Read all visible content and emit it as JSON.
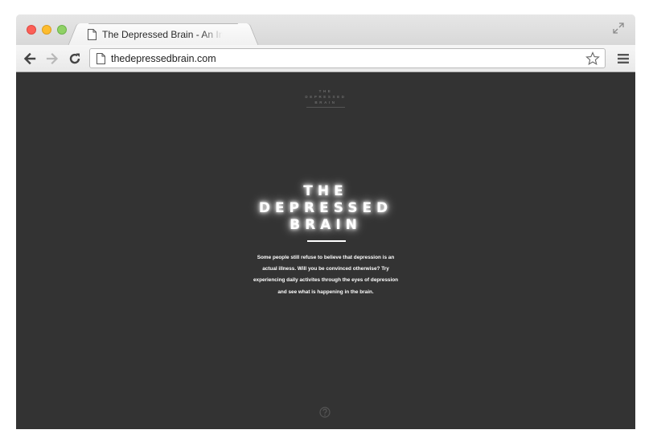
{
  "browser": {
    "tab_title": "The Depressed Brain - An Interactive Experience",
    "url": "thedepressedbrain.com"
  },
  "page": {
    "small_logo": [
      "THE",
      "DEPRESSED",
      "BRAIN"
    ],
    "hero_title": [
      "THE",
      "DEPRESSED",
      "BRAIN"
    ],
    "description": "Some people still refuse to believe that depression is an actual illness. Will you be convinced otherwise? Try experiencing daily activites through the eyes of depression and see what is happening in the brain.",
    "help_icon": "question-mark-icon"
  },
  "colors": {
    "page_background": "#333333",
    "hero_text": "#ffffff"
  }
}
